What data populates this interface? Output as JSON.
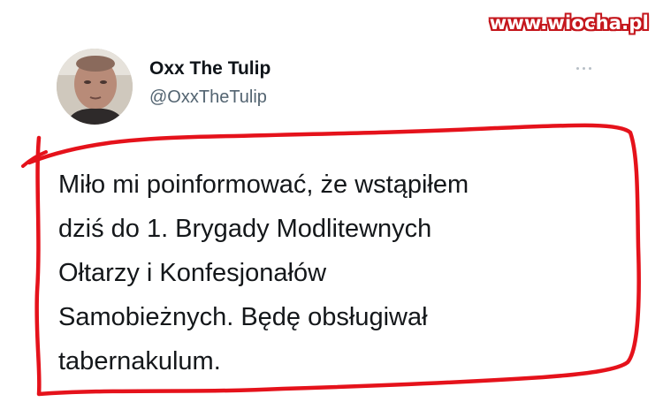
{
  "watermark": {
    "text": "www.wiocha.pl"
  },
  "tweet": {
    "author": {
      "display_name": "Oxx The Tulip",
      "handle": "@OxxTheTulip"
    },
    "more_icon": "more-horizontal-icon",
    "text_lines": [
      "Miło mi poinformować, że wstąpiłem",
      "dziś do 1. Brygady Modlitewnych",
      "Ołtarzy i Konfesjonałów",
      "Samobieżnych. Będę obsługiwał",
      "tabernakulum."
    ]
  },
  "colors": {
    "highlight_outline": "#e5121b",
    "watermark_stroke": "#c4161c",
    "handle": "#536471",
    "text": "#14171a"
  }
}
